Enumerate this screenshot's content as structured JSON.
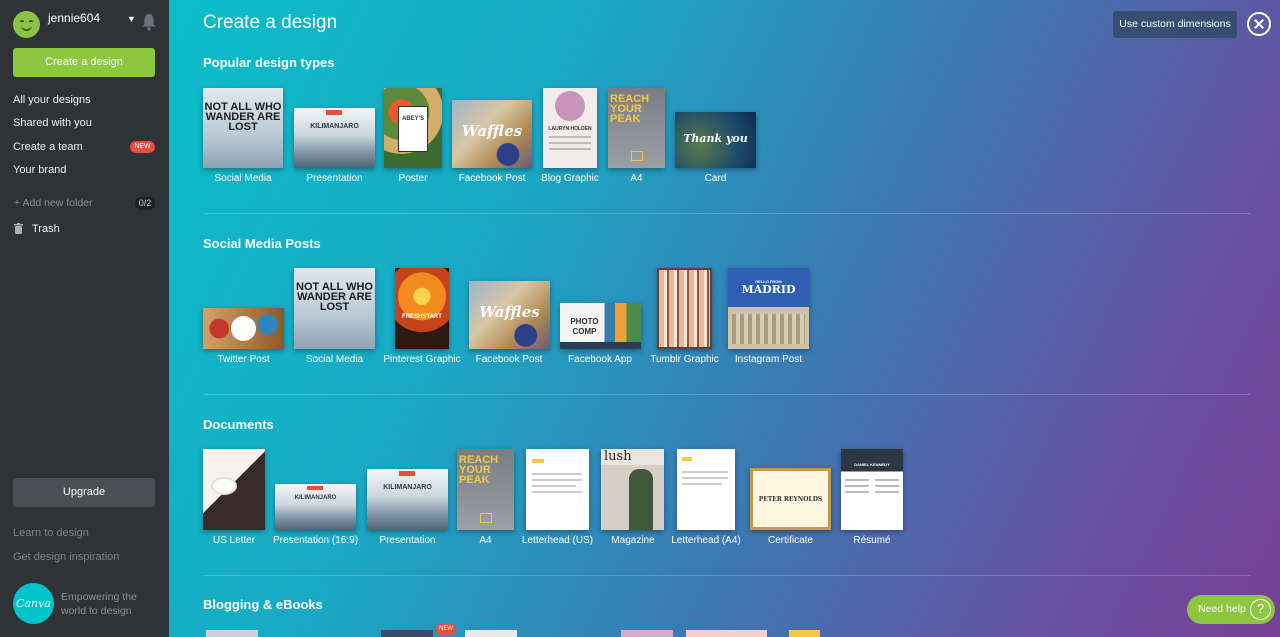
{
  "user": {
    "name": "jennie604"
  },
  "sidebar": {
    "create_label": "Create a design",
    "nav": [
      "All your designs",
      "Shared with you",
      "Create a team",
      "Your brand"
    ],
    "new_badge": "NEW",
    "add_folder": "+ Add new folder",
    "folder_count": "0/2",
    "trash": "Trash",
    "upgrade": "Upgrade",
    "learn": "Learn to design",
    "inspiration": "Get design inspiration",
    "logo": "Canva",
    "tagline": "Empowering the world to design"
  },
  "main": {
    "title": "Create a design",
    "custom_dimensions": "Use custom dimensions",
    "help": "Need help",
    "help_icon": "?",
    "sections": [
      {
        "title": "Popular design types",
        "items": [
          "Social Media",
          "Presentation",
          "Poster",
          "Facebook Post",
          "Blog Graphic",
          "A4",
          "Card"
        ]
      },
      {
        "title": "Social Media Posts",
        "items": [
          "Twitter Post",
          "Social Media",
          "Pinterest Graphic",
          "Facebook Post",
          "Facebook App",
          "Tumblr Graphic",
          "Instagram Post"
        ]
      },
      {
        "title": "Documents",
        "items": [
          "US Letter",
          "Presentation (16:9)",
          "Presentation",
          "A4",
          "Letterhead (US)",
          "Magazine",
          "Letterhead (A4)",
          "Certificate",
          "Résumé"
        ]
      },
      {
        "title": "Blogging & eBooks",
        "items": []
      }
    ],
    "partial_badge": "NEW"
  },
  "thumbs": {
    "not_all": "NOT ALL WHO WANDER ARE LOST",
    "kilimanjaro": "KILIMANJARO",
    "waffles": "Waffles",
    "reach": "REACH YOUR PEAK",
    "thankyou": "Thank you",
    "freshstart": "FRESHSTART",
    "photo_comp": "PHOTO COMP",
    "madrid": "MADRID",
    "hello_from": "HELLO FROM",
    "lush": "lush",
    "peter": "PETER REYNOLDS",
    "daniel": "DANIEL KENNEDY",
    "lauryn": "LAURYN HOLDEN",
    "abeys": "ABEY'S"
  },
  "colors": {
    "sidebar_bg": "#2f3336",
    "accent_green": "#8dc63f",
    "new_badge": "#e84d3d",
    "custom_dim_btn": "#354e72"
  }
}
